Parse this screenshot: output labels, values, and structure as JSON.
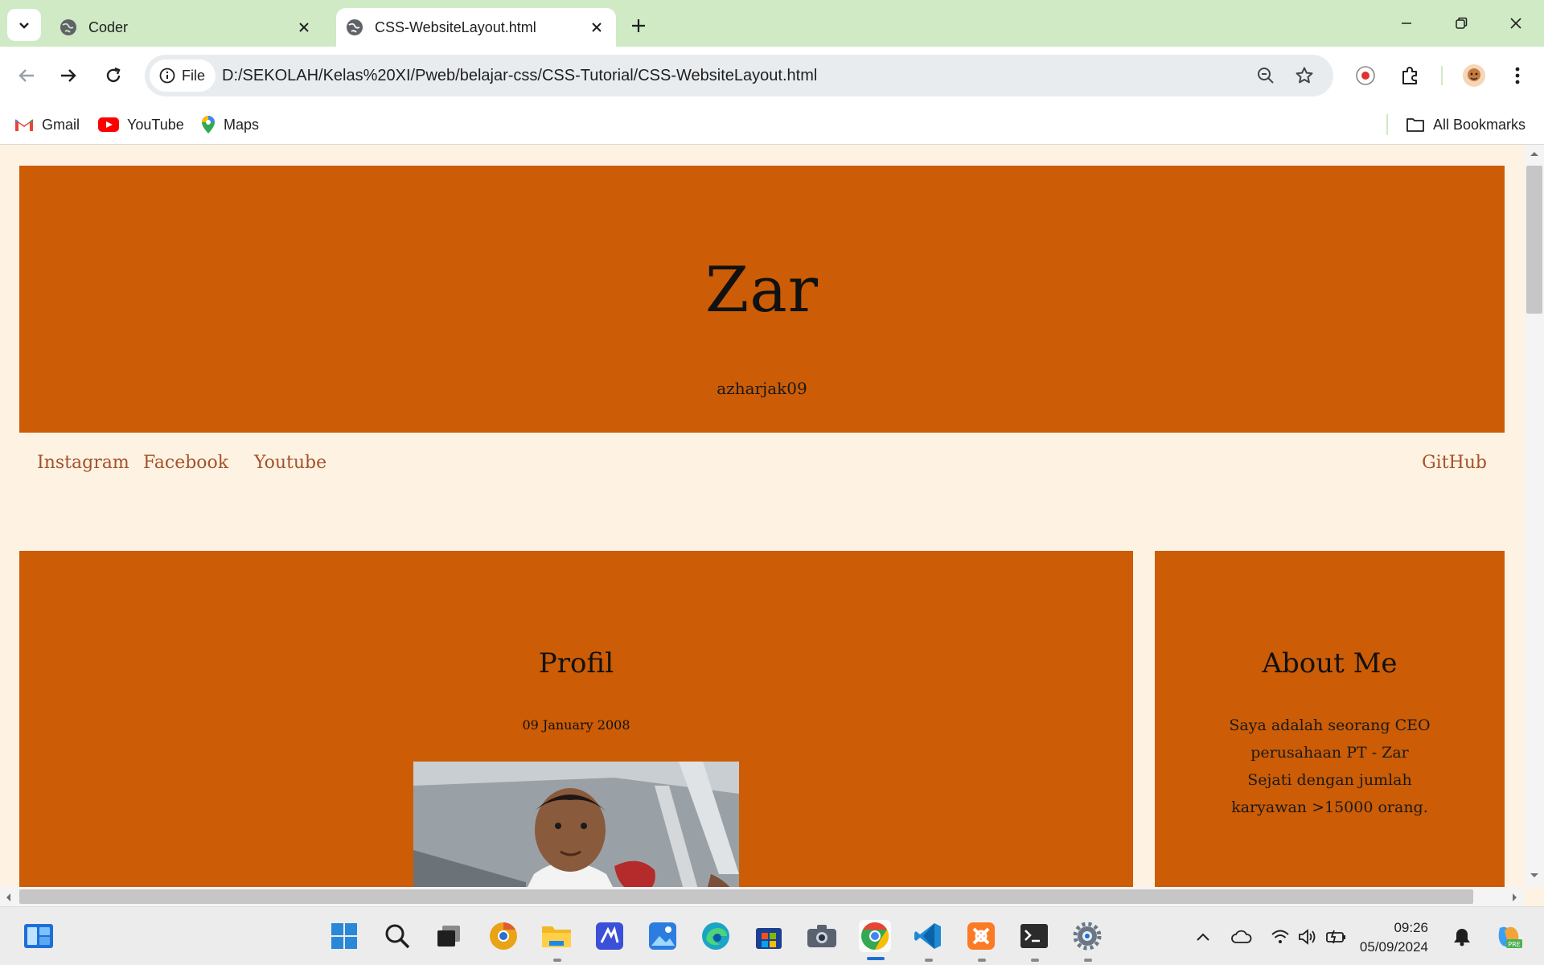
{
  "browser": {
    "tabs": [
      {
        "title": "Coder",
        "active": false
      },
      {
        "title": "CSS-WebsiteLayout.html",
        "active": true
      }
    ],
    "chip_label": "File",
    "url": "D:/SEKOLAH/Kelas%20XI/Pweb/belajar-css/CSS-Tutorial/CSS-WebsiteLayout.html",
    "bookmarks": [
      "Gmail",
      "YouTube",
      "Maps"
    ],
    "all_bookmarks": "All Bookmarks"
  },
  "page": {
    "header": {
      "title": "Zar",
      "subtitle": "azharjak09"
    },
    "nav": {
      "links": [
        "Instagram",
        "Facebook",
        "Youtube"
      ],
      "right_link": "GitHub"
    },
    "main": {
      "title": "Profil",
      "date": "09 January 2008"
    },
    "side": {
      "title": "About Me",
      "text": "Saya adalah seorang CEO perusahaan PT - Zar Sejati dengan jumlah karyawan >15000 orang."
    },
    "colors": {
      "panel": "#cc5c05",
      "background": "#fef3e2",
      "link": "#a6512a"
    }
  },
  "taskbar": {
    "time": "09:26",
    "date": "05/09/2024",
    "apps": [
      "widgets-icon",
      "start-icon",
      "search-icon",
      "task-view-icon",
      "chrome-canary-icon",
      "file-explorer-icon",
      "tool-icon",
      "photos-icon",
      "edge-icon",
      "store-icon",
      "camera-icon",
      "chrome-icon",
      "vscode-icon",
      "xampp-icon",
      "terminal-icon",
      "settings-icon"
    ]
  }
}
